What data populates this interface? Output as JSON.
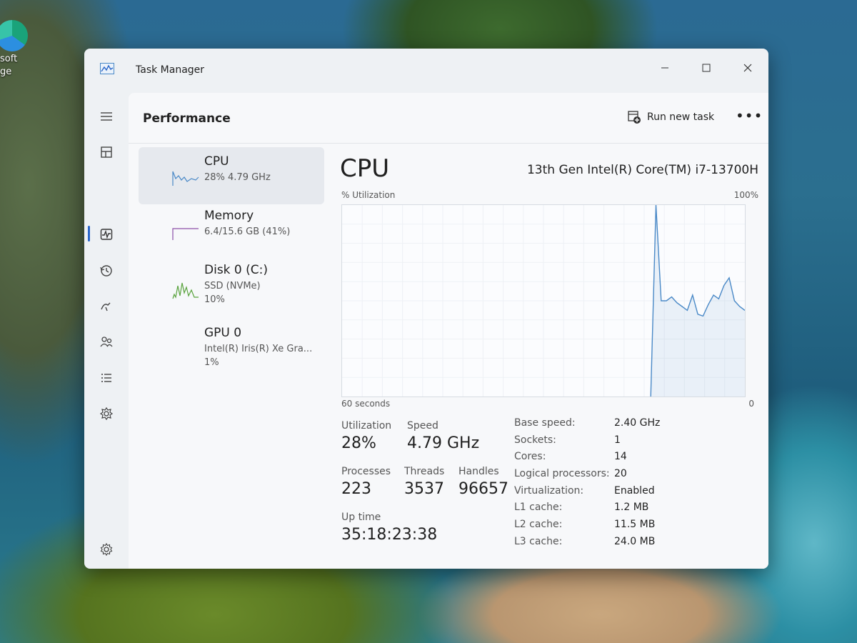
{
  "desktop": {
    "icon_label": "soft\nge"
  },
  "window": {
    "title": "Task Manager",
    "controls": [
      "minimize",
      "maximize",
      "close"
    ]
  },
  "nav": {
    "items": [
      "hamburger-menu",
      "processes",
      "performance",
      "app-history",
      "startup-apps",
      "users",
      "details",
      "services"
    ],
    "settings": "settings",
    "active": "performance",
    "accent": "#2a66c9"
  },
  "header": {
    "title": "Performance",
    "run_new_task": "Run new task",
    "more": "•••"
  },
  "devices": [
    {
      "name": "CPU",
      "sub1": "28%  4.79 GHz",
      "sub2": "",
      "color": "#4a89c7"
    },
    {
      "name": "Memory",
      "sub1": "6.4/15.6 GB (41%)",
      "sub2": "",
      "color": "#8b4fa8"
    },
    {
      "name": "Disk 0 (C:)",
      "sub1": "SSD (NVMe)",
      "sub2": "10%",
      "color": "#5aa33e"
    },
    {
      "name": "GPU 0",
      "sub1": "Intel(R) Iris(R) Xe Gra...",
      "sub2": "1%",
      "color": "#4a89c7"
    }
  ],
  "detail": {
    "title": "CPU",
    "model": "13th Gen Intel(R) Core(TM) i7-13700H",
    "graph_label": "% Utilization",
    "graph_max": "100%",
    "graph_span": "60 seconds",
    "graph_min": "0",
    "stats": {
      "utilization_label": "Utilization",
      "utilization": "28%",
      "speed_label": "Speed",
      "speed": "4.79 GHz",
      "processes_label": "Processes",
      "processes": "223",
      "threads_label": "Threads",
      "threads": "3537",
      "handles_label": "Handles",
      "handles": "96657",
      "uptime_label": "Up time",
      "uptime": "35:18:23:38"
    },
    "specs": [
      {
        "label": "Base speed:",
        "value": "2.40 GHz"
      },
      {
        "label": "Sockets:",
        "value": "1"
      },
      {
        "label": "Cores:",
        "value": "14"
      },
      {
        "label": "Logical processors:",
        "value": "20"
      },
      {
        "label": "Virtualization:",
        "value": "Enabled"
      },
      {
        "label": "L1 cache:",
        "value": "1.2 MB"
      },
      {
        "label": "L2 cache:",
        "value": "11.5 MB"
      },
      {
        "label": "L3 cache:",
        "value": "24.0 MB"
      }
    ]
  },
  "chart_data": {
    "type": "line",
    "ylim": [
      0,
      100
    ],
    "xlabel": "60 seconds",
    "ylabel": "% Utilization",
    "series": [
      {
        "values": [
          0,
          0,
          0,
          0,
          0,
          0,
          0,
          0,
          0,
          0,
          0,
          0,
          0,
          0,
          0,
          0,
          0,
          0,
          0,
          0,
          0,
          0,
          0,
          0,
          0,
          0,
          0,
          0,
          0,
          0,
          0,
          0,
          0,
          0,
          0,
          0,
          0,
          0,
          0,
          0,
          0,
          0,
          0,
          0,
          0,
          0,
          0,
          0,
          0,
          0,
          0,
          0,
          0,
          0,
          0,
          0,
          0,
          0,
          0,
          0,
          100,
          50,
          50,
          52,
          49,
          47,
          45,
          53,
          43,
          42,
          48,
          53,
          51,
          58,
          62,
          50,
          47,
          45
        ]
      }
    ],
    "color": "#4a89c7"
  }
}
